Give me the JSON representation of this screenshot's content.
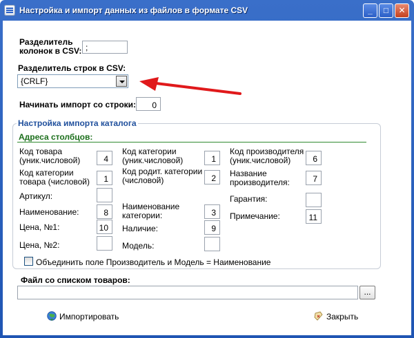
{
  "window": {
    "title": "Настройка и импорт данных из файлов в формате CSV"
  },
  "form": {
    "col_sep_label_1": "Разделитель",
    "col_sep_label_2": "колонок в CSV:",
    "col_sep_value": ";",
    "row_sep_label": "Разделитель строк в CSV:",
    "row_sep_value": "{CRLF}",
    "start_row_label": "Начинать импорт со строки:",
    "start_row_value": "0"
  },
  "catalog": {
    "group_title": "Настройка импорта каталога",
    "section_title": "Адреса столбцов:",
    "fields": {
      "product_code": {
        "label_1": "Код товара",
        "label_2": "(уник.числовой)",
        "value": "4"
      },
      "product_category": {
        "label_1": "Код категории",
        "label_2": "товара (числовой)",
        "value": "1"
      },
      "article": {
        "label_1": "Артикул:",
        "value": ""
      },
      "name": {
        "label_1": "Наименование:",
        "value": "8"
      },
      "price1": {
        "label_1": "Цена, №1:",
        "value": "10"
      },
      "price2": {
        "label_1": "Цена, №2:",
        "value": ""
      },
      "category_code": {
        "label_1": "Код категории",
        "label_2": "(уник.числовой)",
        "value": "1"
      },
      "parent_category": {
        "label_1": "Код родит. категории",
        "label_2": "(числовой)",
        "value": "2"
      },
      "category_name": {
        "label_1": "Наименование",
        "label_2": "категории:",
        "value": "3"
      },
      "availability": {
        "label_1": "Наличие:",
        "value": "9"
      },
      "model": {
        "label_1": "Модель:",
        "value": ""
      },
      "manufacturer_code": {
        "label_1": "Код производителя",
        "label_2": "(уник.числовой)",
        "value": "6"
      },
      "manufacturer_name": {
        "label_1": "Название",
        "label_2": "производителя:",
        "value": "7"
      },
      "warranty": {
        "label_1": "Гарантия:",
        "value": ""
      },
      "note": {
        "label_1": "Примечание:",
        "value": "11"
      }
    },
    "merge_checkbox_label": "Объединить поле Производитель и Модель = Наименование",
    "merge_checked": false
  },
  "file": {
    "label": "Файл со списком товаров:",
    "path": "",
    "browse_label": "..."
  },
  "buttons": {
    "import_label": "Импортировать",
    "close_label": "Закрыть"
  },
  "colors": {
    "titlebar": "#2659bd",
    "group_title": "#1f4f9c",
    "section_title": "#1b6e1b",
    "arrow": "#e0191b"
  }
}
